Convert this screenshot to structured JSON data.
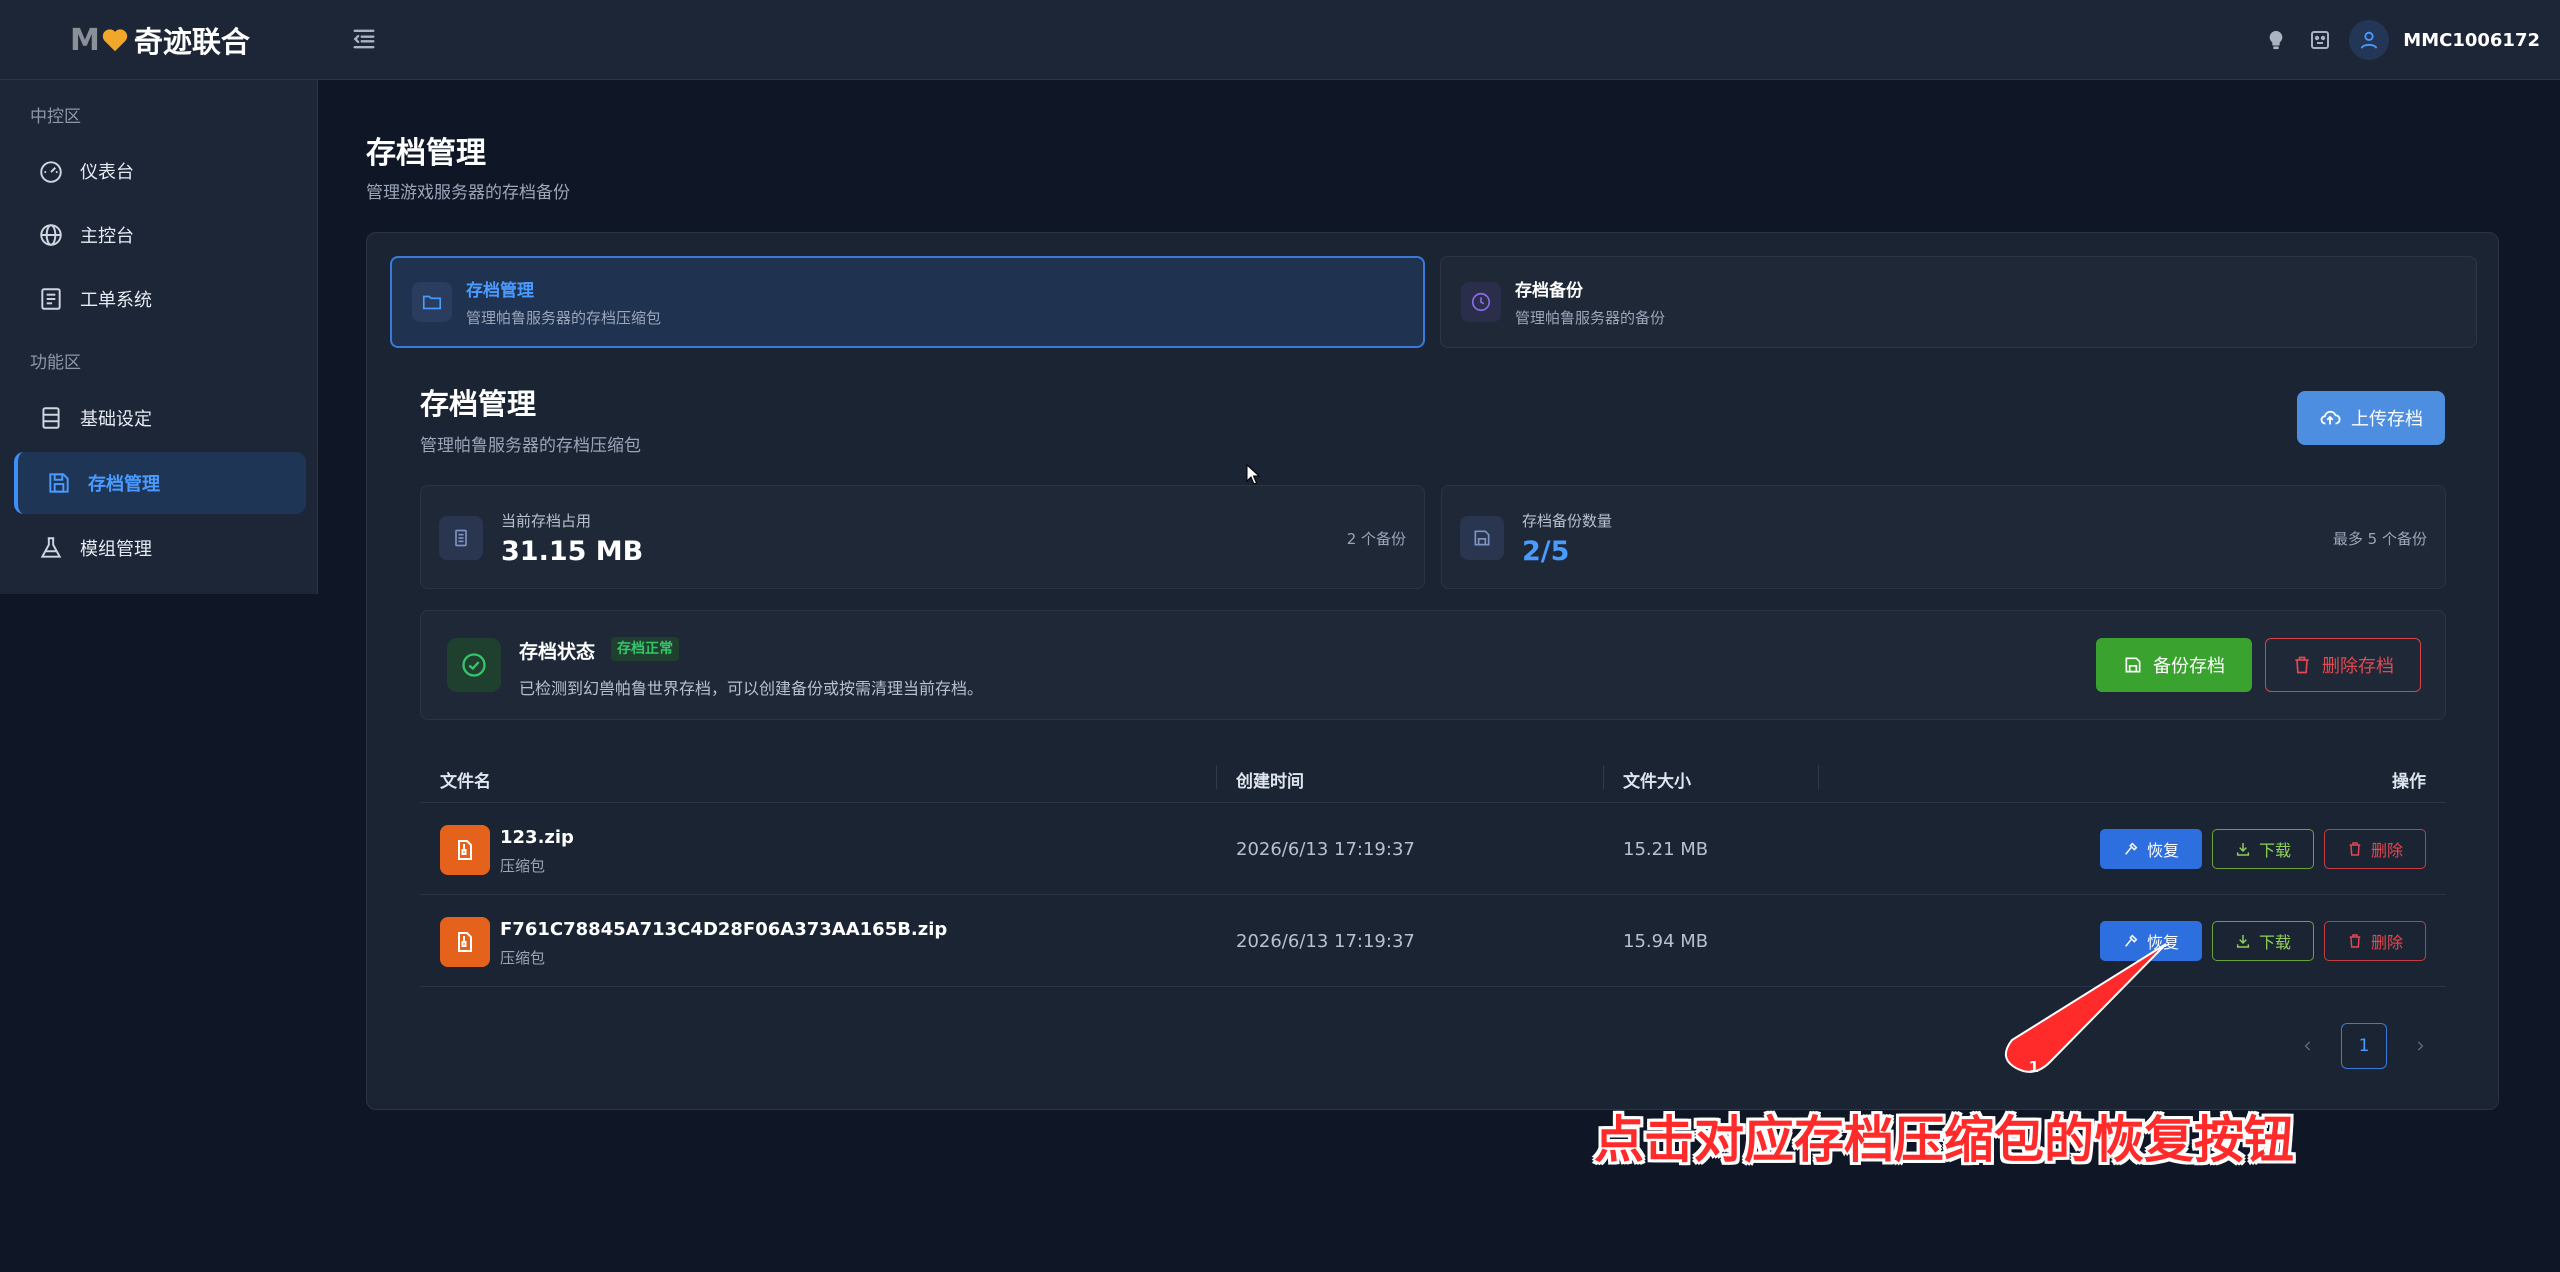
{
  "app": {
    "logo_mark": "M",
    "logo_text": "奇迹联合",
    "username": "MMC1006172"
  },
  "colors": {
    "accent": "#3b8ff6",
    "success": "#3aa22e",
    "danger": "#e5484f",
    "file_icon": "#e5621c",
    "annotation": "#ff2a2a"
  },
  "sidebar": {
    "sections": [
      {
        "label": "中控区",
        "items": [
          {
            "label": "仪表台",
            "icon": "dashboard-icon"
          },
          {
            "label": "主控台",
            "icon": "globe-icon"
          },
          {
            "label": "工单系统",
            "icon": "list-icon"
          }
        ]
      },
      {
        "label": "功能区",
        "items": [
          {
            "label": "基础设定",
            "icon": "server-icon"
          },
          {
            "label": "存档管理",
            "icon": "save-icon",
            "active": true
          },
          {
            "label": "模组管理",
            "icon": "flask-icon"
          }
        ]
      }
    ]
  },
  "page": {
    "title": "存档管理",
    "subtitle": "管理游戏服务器的存档备份"
  },
  "tabs": [
    {
      "title": "存档管理",
      "desc": "管理帕鲁服务器的存档压缩包",
      "icon": "folder-icon",
      "active": true
    },
    {
      "title": "存档备份",
      "desc": "管理帕鲁服务器的备份",
      "icon": "clock-icon"
    }
  ],
  "section": {
    "title": "存档管理",
    "subtitle": "管理帕鲁服务器的存档压缩包",
    "upload_label": "上传存档"
  },
  "stats": [
    {
      "label": "当前存档占用",
      "value": "31.15 MB",
      "note": "2 个备份",
      "icon": "storage-icon"
    },
    {
      "label": "存档备份数量",
      "value": "2/5",
      "note": "最多 5 个备份",
      "icon": "save-icon"
    }
  ],
  "status": {
    "title": "存档状态",
    "badge": "存档正常",
    "desc": "已检测到幻兽帕鲁世界存档，可以创建备份或按需清理当前存档。",
    "backup_label": "备份存档",
    "delete_label": "删除存档"
  },
  "table": {
    "columns": [
      "文件名",
      "创建时间",
      "文件大小",
      "操作"
    ],
    "rows": [
      {
        "name": "123.zip",
        "type": "压缩包",
        "created": "2026/6/13 17:19:37",
        "size": "15.21 MB"
      },
      {
        "name": "F761C78845A713C4D28F06A373AA165B.zip",
        "type": "压缩包",
        "created": "2026/6/13 17:19:37",
        "size": "15.94 MB"
      }
    ],
    "actions": {
      "restore": "恢复",
      "download": "下载",
      "delete": "删除"
    }
  },
  "pagination": {
    "current": "1"
  },
  "annotation": {
    "number": "1",
    "text": "点击对应存档压缩包的恢复按钮"
  }
}
